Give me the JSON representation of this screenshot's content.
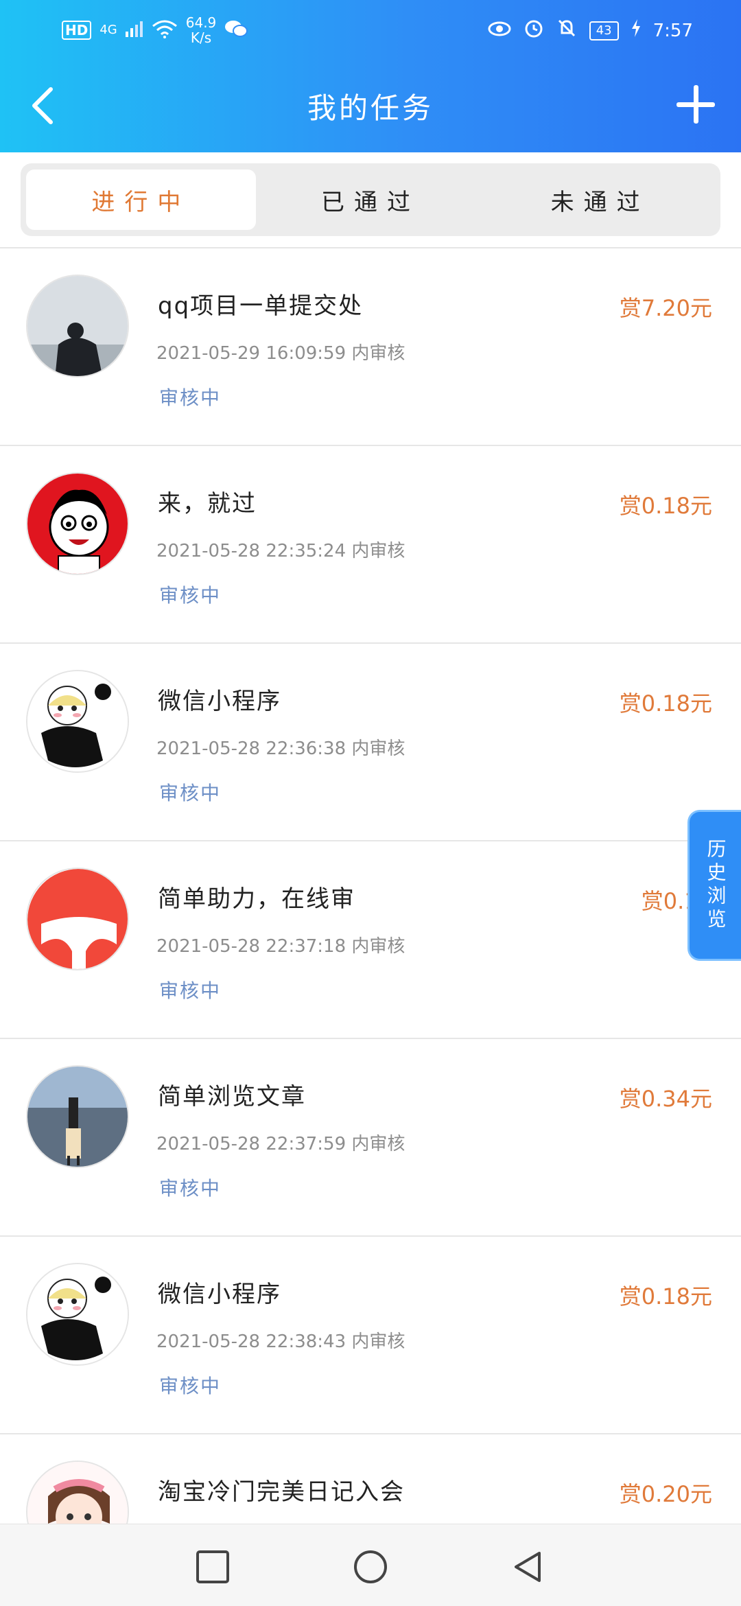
{
  "statusbar": {
    "hd": "HD",
    "network": "4G",
    "speed_value": "64.9",
    "speed_unit": "K/s",
    "battery": "43",
    "time": "7:57",
    "icons": [
      "eye-icon",
      "alarm-icon",
      "bell-muted-icon",
      "charging-icon",
      "wifi-icon",
      "signal-icon",
      "wechat-icon"
    ]
  },
  "topbar": {
    "title": "我的任务"
  },
  "tabs": [
    {
      "label": "进行中",
      "active": true
    },
    {
      "label": "已通过",
      "active": false
    },
    {
      "label": "未通过",
      "active": false
    }
  ],
  "tasks": [
    {
      "title": "qq项目一单提交处",
      "meta": "2021-05-29 16:09:59 内审核",
      "status": "审核中",
      "reward": "赏7.20元"
    },
    {
      "title": "来，就过",
      "meta": "2021-05-28 22:35:24 内审核",
      "status": "审核中",
      "reward": "赏0.18元"
    },
    {
      "title": "微信小程序",
      "meta": "2021-05-28 22:36:38 内审核",
      "status": "审核中",
      "reward": "赏0.18元"
    },
    {
      "title": "简单助力，在线审",
      "meta": "2021-05-28 22:37:18 内审核",
      "status": "审核中",
      "reward": "赏0.18"
    },
    {
      "title": "简单浏览文章",
      "meta": "2021-05-28 22:37:59 内审核",
      "status": "审核中",
      "reward": "赏0.34元"
    },
    {
      "title": "微信小程序",
      "meta": "2021-05-28 22:38:43 内审核",
      "status": "审核中",
      "reward": "赏0.18元"
    },
    {
      "title": "淘宝冷门完美日记入会",
      "meta": "",
      "status": "",
      "reward": "赏0.20元"
    }
  ],
  "history_label": "历史浏览",
  "colors": {
    "header_start": "#1fc2f5",
    "header_end": "#2b73f3",
    "accent_orange": "#e07a3a",
    "status_blue": "#6d8fc6"
  }
}
